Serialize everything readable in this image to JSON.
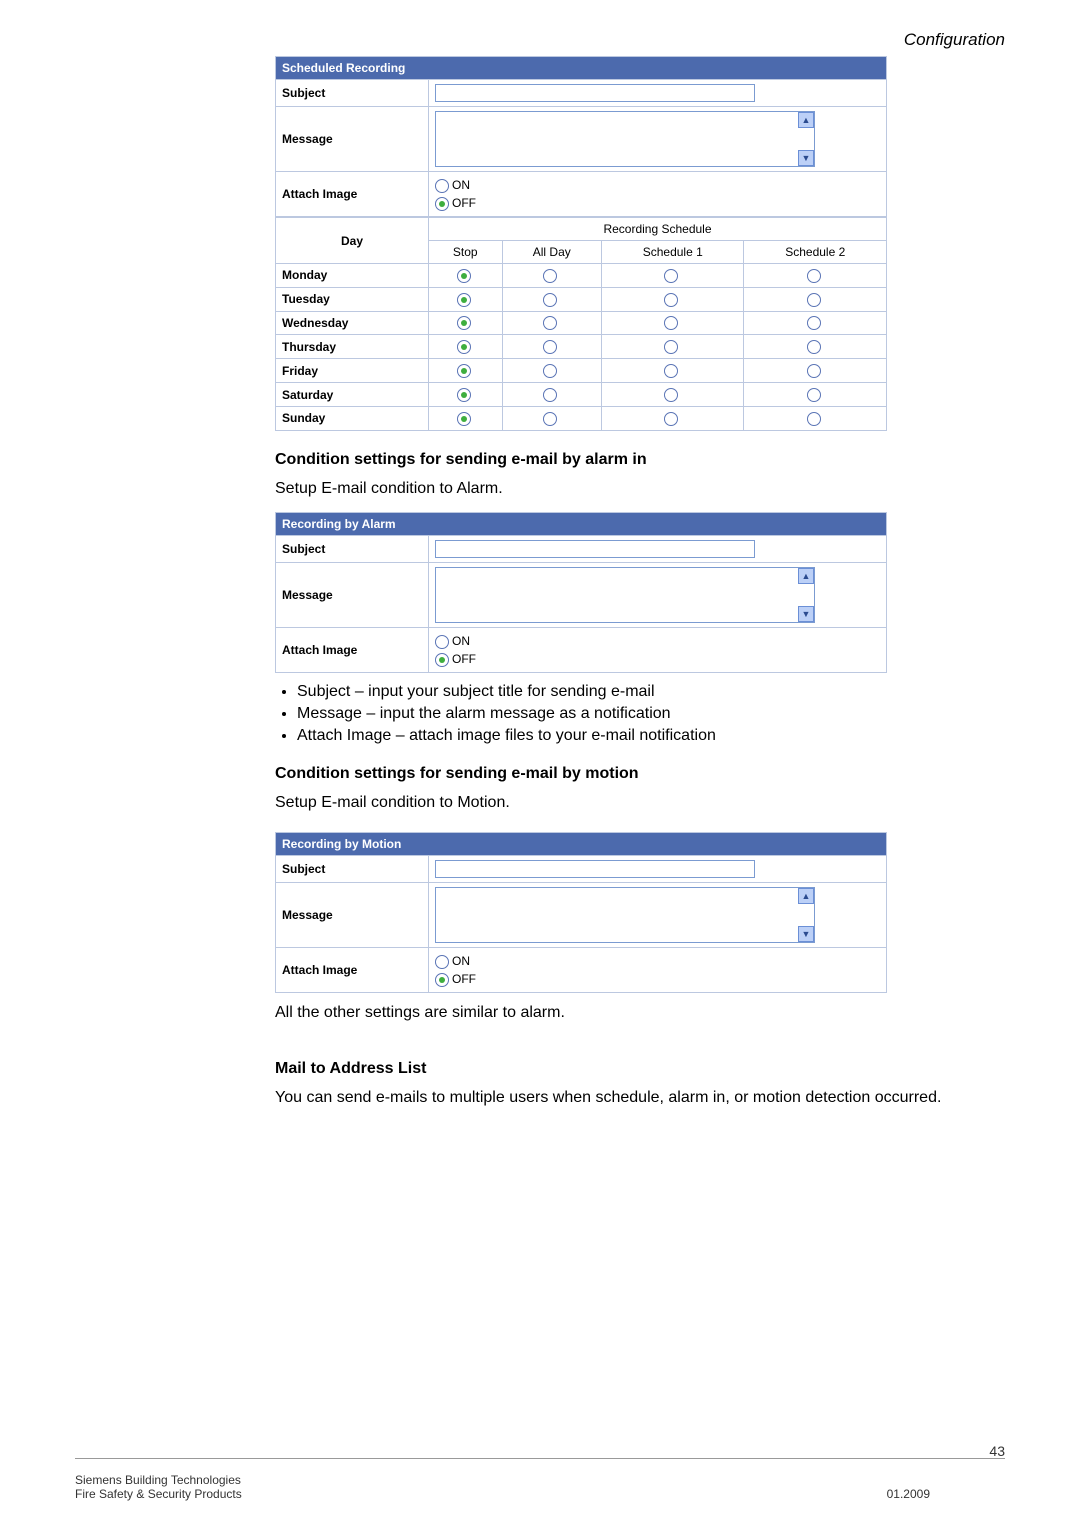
{
  "header": {
    "title": "Configuration"
  },
  "scheduled": {
    "title": "Scheduled Recording",
    "subject_label": "Subject",
    "subject_value": "",
    "message_label": "Message",
    "message_value": "",
    "attach_label": "Attach Image",
    "attach_on": "ON",
    "attach_off": "OFF",
    "attach_selected": "OFF",
    "day_header": "Day",
    "schedule_header": "Recording Schedule",
    "columns": [
      "Stop",
      "All Day",
      "Schedule 1",
      "Schedule 2"
    ],
    "rows": [
      {
        "day": "Monday",
        "sel": "Stop"
      },
      {
        "day": "Tuesday",
        "sel": "Stop"
      },
      {
        "day": "Wednesday",
        "sel": "Stop"
      },
      {
        "day": "Thursday",
        "sel": "Stop"
      },
      {
        "day": "Friday",
        "sel": "Stop"
      },
      {
        "day": "Saturday",
        "sel": "Stop"
      },
      {
        "day": "Sunday",
        "sel": "Stop"
      }
    ]
  },
  "alarm_section": {
    "heading": "Condition settings for sending e-mail by alarm in",
    "subhead": "Setup E-mail condition to Alarm.",
    "panel_title": "Recording by Alarm",
    "subject_label": "Subject",
    "subject_value": "",
    "message_label": "Message",
    "message_value": "",
    "attach_label": "Attach Image",
    "attach_on": "ON",
    "attach_off": "OFF",
    "attach_selected": "OFF"
  },
  "bullets": [
    "Subject – input your subject title for sending e-mail",
    "Message – input the alarm message as a notification",
    "Attach Image – attach image files to your e-mail notification"
  ],
  "motion_section": {
    "heading": "Condition settings for sending e-mail by motion",
    "subhead": "Setup E-mail condition to Motion.",
    "panel_title": "Recording by Motion",
    "subject_label": "Subject",
    "subject_value": "",
    "message_label": "Message",
    "message_value": "",
    "attach_label": "Attach Image",
    "attach_on": "ON",
    "attach_off": "OFF",
    "attach_selected": "OFF"
  },
  "motion_note": "All the other settings are similar to alarm.",
  "mail_list": {
    "heading": "Mail to Address List",
    "text": "You can send e-mails to multiple users when schedule, alarm in, or motion detection occurred."
  },
  "footer": {
    "page": "43",
    "line1": "Siemens Building Technologies",
    "line2": "Fire Safety & Security Products",
    "date": "01.2009"
  }
}
